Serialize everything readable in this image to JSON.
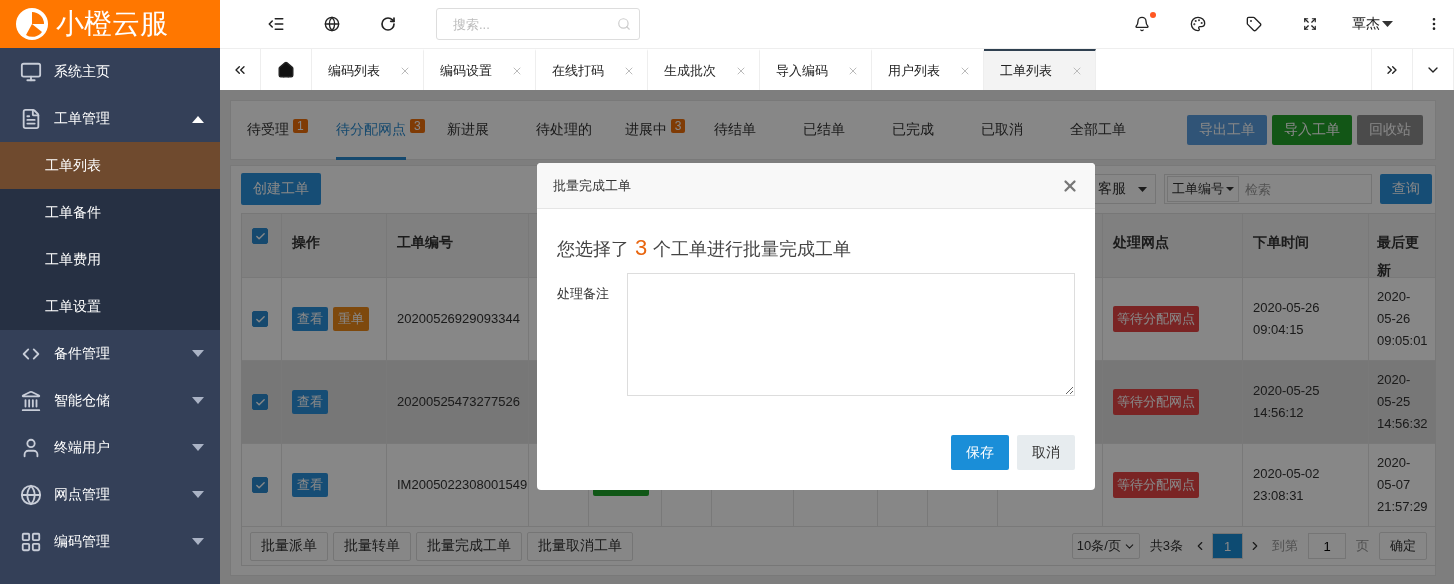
{
  "logo": {
    "text": "小橙云服"
  },
  "sidebar": {
    "items": [
      {
        "label": "系统主页"
      },
      {
        "label": "工单管理",
        "expanded": true,
        "children": [
          {
            "label": "工单列表",
            "selected": true
          },
          {
            "label": "工单备件",
            "selected": false
          },
          {
            "label": "工单费用",
            "selected": false
          },
          {
            "label": "工单设置",
            "selected": false
          }
        ]
      },
      {
        "label": "备件管理",
        "expanded": false
      },
      {
        "label": "智能仓储",
        "expanded": false
      },
      {
        "label": "终端用户",
        "expanded": false
      },
      {
        "label": "网点管理",
        "expanded": false
      },
      {
        "label": "编码管理",
        "expanded": false
      }
    ]
  },
  "topbar": {
    "search": {
      "placeholder": "搜索..."
    },
    "notifications": {
      "unread": true
    },
    "user": "覃杰"
  },
  "page_tabs": [
    {
      "label": "编码列表",
      "selected": false
    },
    {
      "label": "编码设置",
      "selected": false
    },
    {
      "label": "在线打码",
      "selected": false
    },
    {
      "label": "生成批次",
      "selected": false
    },
    {
      "label": "导入编码",
      "selected": false
    },
    {
      "label": "用户列表",
      "selected": false
    },
    {
      "label": "工单列表",
      "selected": true
    }
  ],
  "status_tabs": [
    {
      "label": "待受理",
      "count": "1",
      "selected": false
    },
    {
      "label": "待分配网点",
      "count": "3",
      "selected": true
    },
    {
      "label": "新进展",
      "selected": false
    },
    {
      "label": "待处理的",
      "selected": false
    },
    {
      "label": "进展中",
      "count": "3",
      "selected": false
    },
    {
      "label": "待结单",
      "selected": false
    },
    {
      "label": "已结单",
      "selected": false
    },
    {
      "label": "已完成",
      "selected": false
    },
    {
      "label": "已取消",
      "selected": false
    },
    {
      "label": "全部工单",
      "selected": false
    }
  ],
  "actions": [
    {
      "label": "导出工单",
      "kind": "primary"
    },
    {
      "label": "导入工单",
      "kind": "success"
    },
    {
      "label": "回收站",
      "kind": "default"
    }
  ],
  "toolbar": {
    "create": "创建工单",
    "service_select": "客服",
    "search_field": "工单编号",
    "search_placeholder": "检索",
    "query": "查询"
  },
  "table": {
    "select_all": true,
    "columns": {
      "actions": "操作",
      "order_no": "工单编号",
      "network": "处理网点",
      "order_time": "下单时间",
      "updated": "最后更新"
    },
    "rows": [
      {
        "checked": true,
        "hovered": false,
        "buttons": [
          {
            "label": "查看",
            "kind": "view"
          },
          {
            "label": "重单",
            "kind": "duplicate"
          }
        ],
        "order_no": "20200526929093344",
        "tag": false,
        "network": "等待分配网点",
        "order_time": "2020-05-26 09:04:15",
        "updated": "2020- 05-26 09:05:01"
      },
      {
        "checked": true,
        "hovered": true,
        "buttons": [
          {
            "label": "查看",
            "kind": "view"
          }
        ],
        "order_no": "20200525473277526",
        "tag": false,
        "network": "等待分配网点",
        "order_time": "2020-05-25 14:56:12",
        "updated": "2020- 05-25 14:56:32"
      },
      {
        "checked": true,
        "hovered": false,
        "buttons": [
          {
            "label": "查看",
            "kind": "view"
          }
        ],
        "order_no": "IM2005022308001549",
        "tag": true,
        "network": "等待分配网点",
        "order_time": "2020-05-02 23:08:31",
        "updated": "2020- 05-07 21:57:29"
      }
    ]
  },
  "batch_buttons": [
    "批量派单",
    "批量转单",
    "批量完成工单",
    "批量取消工单"
  ],
  "pagination": {
    "page_size": "10条/页",
    "total": "共3条",
    "pages": [
      {
        "label": "1",
        "selected": true
      }
    ],
    "goto_label": "到第",
    "goto_value": "1",
    "page_unit": "页",
    "confirm": "确定"
  },
  "modal": {
    "title": "批量完成工单",
    "message_prefix": "您选择了",
    "count": "3",
    "message_suffix": "个工单进行批量完成工单",
    "field_label": "处理备注",
    "buttons": [
      {
        "label": "保存",
        "kind": "primary"
      },
      {
        "label": "取消",
        "kind": "default"
      }
    ]
  }
}
